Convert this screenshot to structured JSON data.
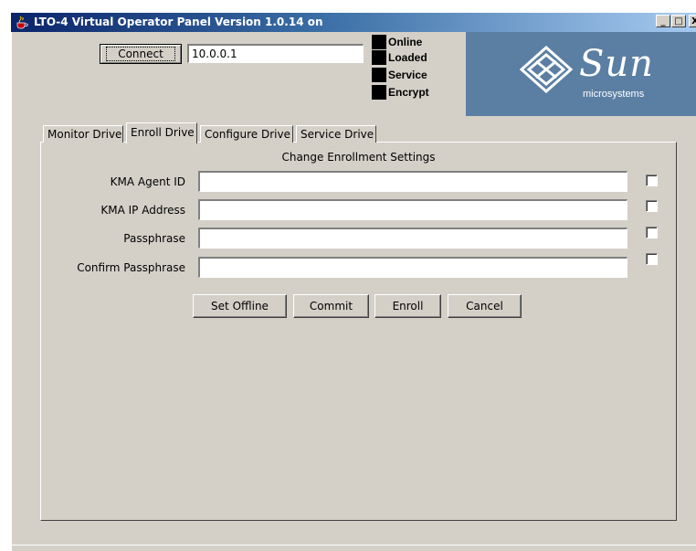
{
  "window": {
    "title": "LTO-4 Virtual Operator Panel Version 1.0.14 on",
    "controls": {
      "minimize": "_",
      "maximize": "□",
      "close": "X"
    }
  },
  "connection": {
    "connect_label": "Connect",
    "ip_value": "10.0.0.1"
  },
  "status_indicators": [
    {
      "label": "Online"
    },
    {
      "label": "Loaded"
    },
    {
      "label": "Service"
    },
    {
      "label": "Encrypt"
    }
  ],
  "logo": {
    "word": "Sun",
    "sub": "microsystems"
  },
  "tabs": [
    {
      "label": "Monitor Drive",
      "active": false
    },
    {
      "label": "Enroll Drive",
      "active": true
    },
    {
      "label": "Configure Drive",
      "active": false
    },
    {
      "label": "Service Drive",
      "active": false
    }
  ],
  "enroll": {
    "heading": "Change Enrollment Settings",
    "fields": [
      {
        "label": "KMA Agent ID",
        "value": ""
      },
      {
        "label": "KMA IP Address",
        "value": ""
      },
      {
        "label": "Passphrase",
        "value": ""
      },
      {
        "label": "Confirm Passphrase",
        "value": ""
      }
    ],
    "buttons": {
      "set_offline": "Set Offline",
      "commit": "Commit",
      "enroll": "Enroll",
      "cancel": "Cancel"
    }
  },
  "colors": {
    "title_bar_start": "#0a246a",
    "title_bar_end": "#a6caf0",
    "window_bg": "#d4d0c8",
    "logo_bg": "#5b7fa3"
  }
}
